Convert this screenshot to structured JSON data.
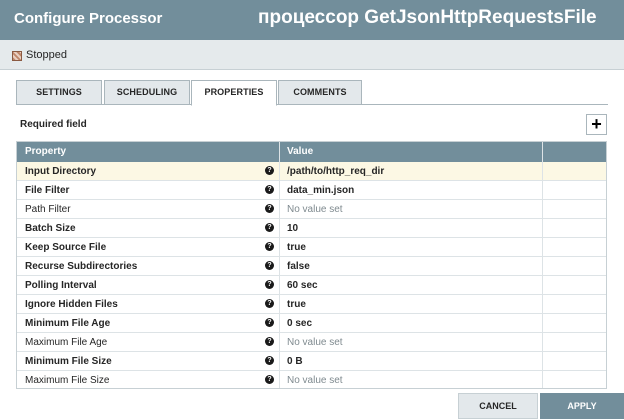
{
  "dialog": {
    "title": "Configure Processor",
    "overlay_caption": "процессор GetJsonHttpRequestsFile"
  },
  "status": {
    "text": "Stopped",
    "icon": "stopped-icon"
  },
  "tabs": [
    {
      "label": "SETTINGS",
      "active": false
    },
    {
      "label": "SCHEDULING",
      "active": false
    },
    {
      "label": "PROPERTIES",
      "active": true
    },
    {
      "label": "COMMENTS",
      "active": false
    }
  ],
  "properties_panel": {
    "required_label": "Required field",
    "add_button": "+",
    "columns": {
      "property": "Property",
      "value": "Value"
    },
    "help_glyph": "?",
    "rows": [
      {
        "name": "Input Directory",
        "value": "/path/to/http_req_dir",
        "required": true,
        "set": true,
        "selected": true
      },
      {
        "name": "File Filter",
        "value": "data_min.json",
        "required": true,
        "set": true,
        "selected": false
      },
      {
        "name": "Path Filter",
        "value": "No value set",
        "required": false,
        "set": false,
        "selected": false
      },
      {
        "name": "Batch Size",
        "value": "10",
        "required": true,
        "set": true,
        "selected": false
      },
      {
        "name": "Keep Source File",
        "value": "true",
        "required": true,
        "set": true,
        "selected": false
      },
      {
        "name": "Recurse Subdirectories",
        "value": "false",
        "required": true,
        "set": true,
        "selected": false
      },
      {
        "name": "Polling Interval",
        "value": "60 sec",
        "required": true,
        "set": true,
        "selected": false
      },
      {
        "name": "Ignore Hidden Files",
        "value": "true",
        "required": true,
        "set": true,
        "selected": false
      },
      {
        "name": "Minimum File Age",
        "value": "0 sec",
        "required": true,
        "set": true,
        "selected": false
      },
      {
        "name": "Maximum File Age",
        "value": "No value set",
        "required": false,
        "set": false,
        "selected": false
      },
      {
        "name": "Minimum File Size",
        "value": "0 B",
        "required": true,
        "set": true,
        "selected": false
      },
      {
        "name": "Maximum File Size",
        "value": "No value set",
        "required": false,
        "set": false,
        "selected": false
      }
    ]
  },
  "footer": {
    "cancel_label": "CANCEL",
    "apply_label": "APPLY"
  },
  "colors": {
    "header": "#728e9b",
    "selected_row": "#fcf8e4",
    "tab_inactive": "#e3e8eb"
  }
}
